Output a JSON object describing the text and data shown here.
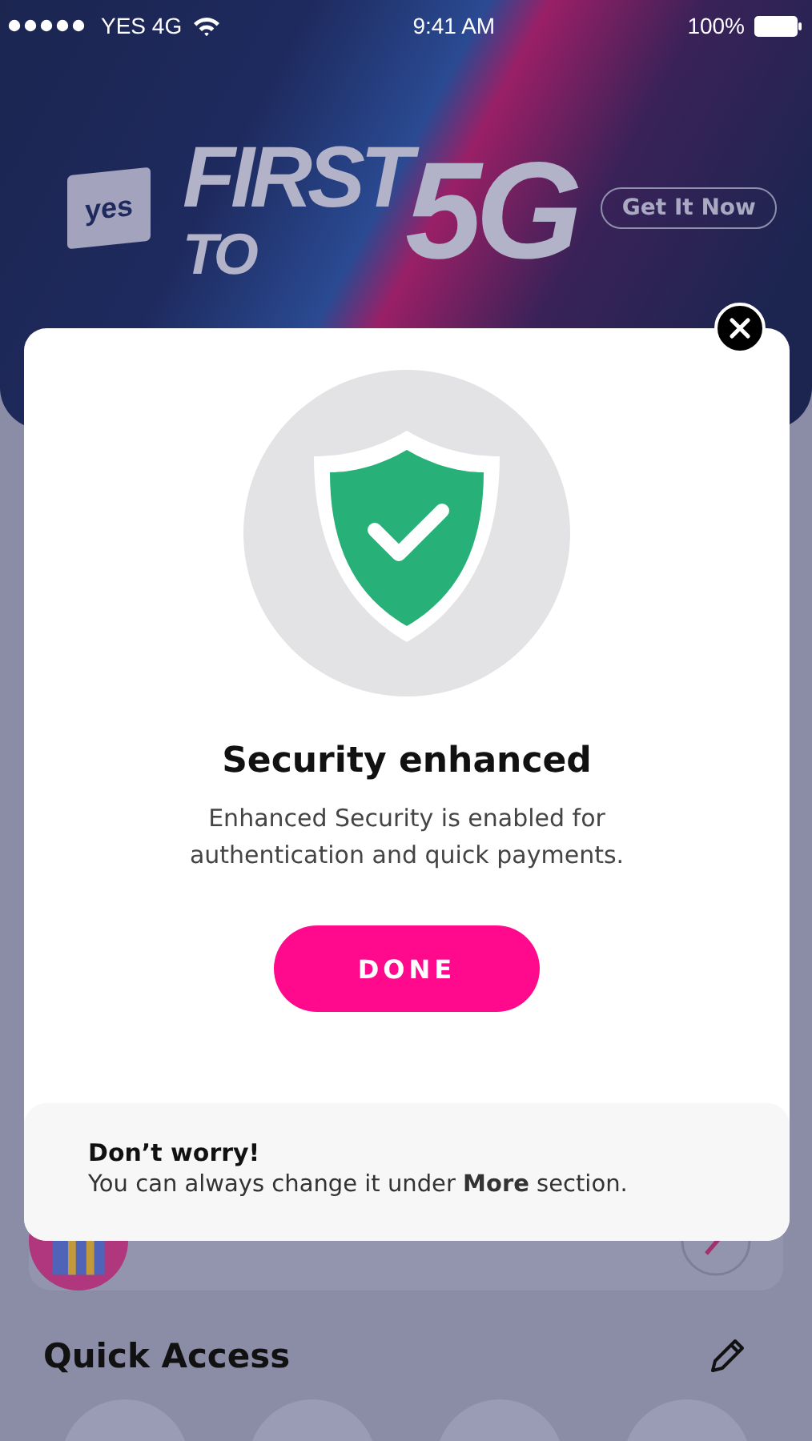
{
  "status_bar": {
    "carrier": "YES 4G",
    "time": "9:41 AM",
    "battery": "100%"
  },
  "banner": {
    "logo": "yes",
    "headline_top": "FIRST",
    "headline_bottom": "TO",
    "headline_big": "5G",
    "button": "Get It Now"
  },
  "background": {
    "section_title": "Quick Access"
  },
  "dialog": {
    "title": "Security enhanced",
    "message": "Enhanced Security is enabled for authentication and quick payments.",
    "button": "DONE",
    "note_title": "Don’t worry!",
    "note_text": "You can always change it under **More** section."
  }
}
